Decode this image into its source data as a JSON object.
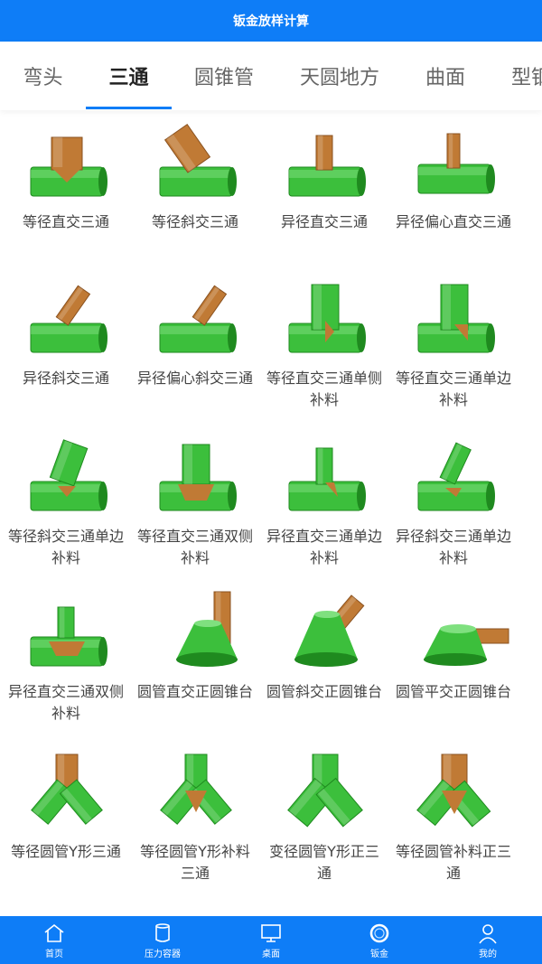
{
  "header": {
    "title": "钣金放样计算"
  },
  "tabs": [
    {
      "label": "弯头"
    },
    {
      "label": "三通"
    },
    {
      "label": "圆锥管"
    },
    {
      "label": "天圆地方"
    },
    {
      "label": "曲面"
    },
    {
      "label": "型钢"
    }
  ],
  "items": [
    {
      "label": "等径直交三通",
      "shape": "tee-equal-straight"
    },
    {
      "label": "等径斜交三通",
      "shape": "tee-equal-oblique"
    },
    {
      "label": "异径直交三通",
      "shape": "tee-reducing-straight"
    },
    {
      "label": "异径偏心直交三通",
      "shape": "tee-eccentric-straight"
    },
    {
      "label": "异径斜交三通",
      "shape": "tee-reducing-oblique"
    },
    {
      "label": "异径偏心斜交三通",
      "shape": "tee-eccentric-oblique"
    },
    {
      "label": "等径直交三通单侧补料",
      "shape": "tee-single-patch"
    },
    {
      "label": "等径直交三通单边补料",
      "shape": "tee-single-edge-patch"
    },
    {
      "label": "等径斜交三通单边补料",
      "shape": "tee-oblique-edge-patch"
    },
    {
      "label": "等径直交三通双侧补料",
      "shape": "tee-double-patch"
    },
    {
      "label": "异径直交三通单边补料",
      "shape": "tee-reducing-edge-patch"
    },
    {
      "label": "异径斜交三通单边补料",
      "shape": "tee-reducing-oblique-patch"
    },
    {
      "label": "异径直交三通双侧补料",
      "shape": "tee-reducing-double-patch"
    },
    {
      "label": "圆管直交正圆锥台",
      "shape": "cone-pipe-vertical"
    },
    {
      "label": "圆管斜交正圆锥台",
      "shape": "cone-pipe-oblique"
    },
    {
      "label": "圆管平交正圆锥台",
      "shape": "cone-pipe-horizontal"
    },
    {
      "label": "等径圆管Y形三通",
      "shape": "y-equal"
    },
    {
      "label": "等径圆管Y形补料三通",
      "shape": "y-equal-patch"
    },
    {
      "label": "变径圆管Y形正三通",
      "shape": "y-reducing"
    },
    {
      "label": "等径圆管补料正三通",
      "shape": "y-patch-regular"
    }
  ],
  "bottom_nav": [
    {
      "label": "首页",
      "icon": "home-icon"
    },
    {
      "label": "压力容器",
      "icon": "vessel-icon"
    },
    {
      "label": "桌面",
      "icon": "monitor-icon"
    },
    {
      "label": "钣金",
      "icon": "ring-icon"
    },
    {
      "label": "我的",
      "icon": "user-icon"
    }
  ],
  "colors": {
    "accent": "#0e7df7",
    "pipe_green": "#3cbf3c",
    "pipe_brown": "#c07a35"
  }
}
